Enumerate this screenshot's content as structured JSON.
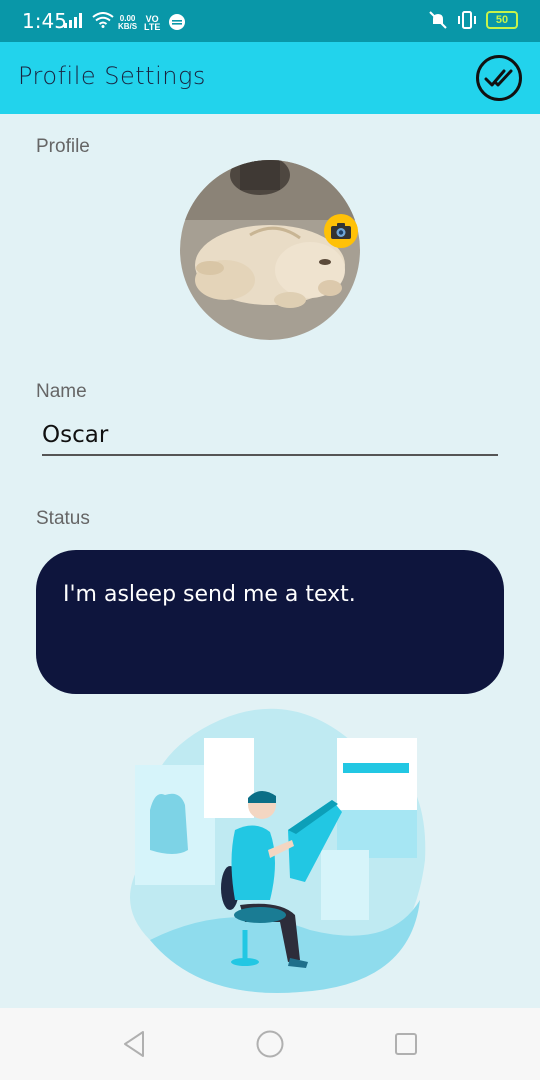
{
  "status_bar": {
    "time": "1:45",
    "net_speed_value": "0.00",
    "net_speed_unit": "KB/S",
    "volte_top": "VO",
    "volte_bottom": "LTE",
    "battery": "50"
  },
  "app_bar": {
    "title": "Profile Settings",
    "done_icon": "double-check-icon"
  },
  "profile": {
    "label": "Profile",
    "avatar_icon": "sleeping-puppy-photo",
    "camera_icon": "camera-icon"
  },
  "name": {
    "label": "Name",
    "value": "Oscar"
  },
  "status": {
    "label": "Status",
    "value": "I'm asleep send me a text."
  },
  "nav": {
    "back_icon": "back-triangle-icon",
    "home_icon": "home-circle-icon",
    "recents_icon": "recents-square-icon"
  },
  "colors": {
    "status_bar": "#0997a8",
    "app_bar": "#22d3ec",
    "background": "#e2f2f5",
    "status_box": "#0e153d",
    "camera_badge": "#ffc107"
  }
}
